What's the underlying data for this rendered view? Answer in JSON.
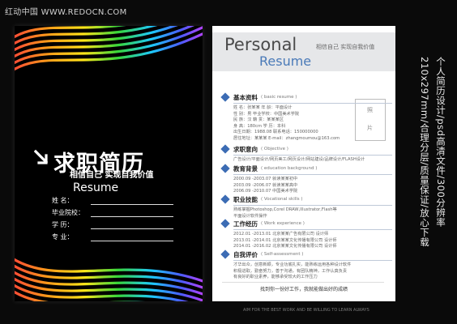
{
  "watermark": "红动中国 WWW.REDOCN.COM",
  "cover": {
    "title": "求职简历",
    "slogan": "相信自己  实现自我价值",
    "resume": "Resume",
    "fields": [
      "姓    名：",
      "毕业院校：",
      "学    历：",
      "专    业："
    ]
  },
  "page": {
    "personal": "Personal",
    "head_slogan": "相信自己  实现自我价值",
    "resume": "Resume",
    "photo_label_1": "照",
    "photo_label_2": "片",
    "sections": [
      {
        "title": "基本资料",
        "sub": "( basic resume )",
        "lines": [
          "姓    名：张某某              年    龄：平面设计",
          "性    别：男                    毕业学校：中国美术学院",
          "民    族：汉                    籍    贯：某某某区",
          "身    高：180cm              学    历：本科",
          "出生日期：1988.08            联系电话：150000000",
          "居住地址：某某某              E-mail：zhangmoumou@163.com"
        ]
      },
      {
        "title": "求职意向",
        "sub": "( Objective )",
        "lines": [
          "广告设计/平面设计/网页美工/网页设计/网站建设/品牌设计/FLASH设计"
        ]
      },
      {
        "title": "教育背景",
        "sub": "( education background )",
        "lines": [
          "2000.09 -2003.07 就读某某初中",
          "2003.09 -2006.07 就读某某高中",
          "2006.09 -2010.07 中国美术学院"
        ]
      },
      {
        "title": "职业技能",
        "sub": "( Vocational skills )",
        "lines": [
          "熟练掌握Photoshop,Corel DRAW,Illustrator,Flash等",
          "平面设计软件操作"
        ]
      },
      {
        "title": "工作经历",
        "sub": "( Work experience )",
        "lines": [
          "2012.01 -2013.01 北京某某广告有限公司    设计师",
          "2013.01 -2014.01 北京某某文化传播有限公司    设计师",
          "2014.01 -2016.02 北京某某文化传播有限公司    设计师"
        ]
      },
      {
        "title": "自我评价",
        "sub": "( Self-assessment )",
        "lines": [
          "才华出众，创意新颖，专业功底扎实，能熟练运用各种设计软件",
          "积极进取，勤奋努力，善于沟通，有团队精神，工作认真负责",
          "有良好的职业素养，能够承受较大的工作压力"
        ]
      }
    ],
    "footer": "找到你一份好工作，我就能做出好的成绩",
    "footer2": "AIM FOR THE BEST WORK  AND BE WILLING TO LEARN ALWAYS"
  },
  "vertical_text": {
    "col1": "个人简历设计/psd高清文件/300分辨率",
    "col2": "210x297mm/合理分层/质量保证/放心下载"
  },
  "colors": {
    "accent": "#3c6cb4",
    "background": "#0a0a0a"
  }
}
